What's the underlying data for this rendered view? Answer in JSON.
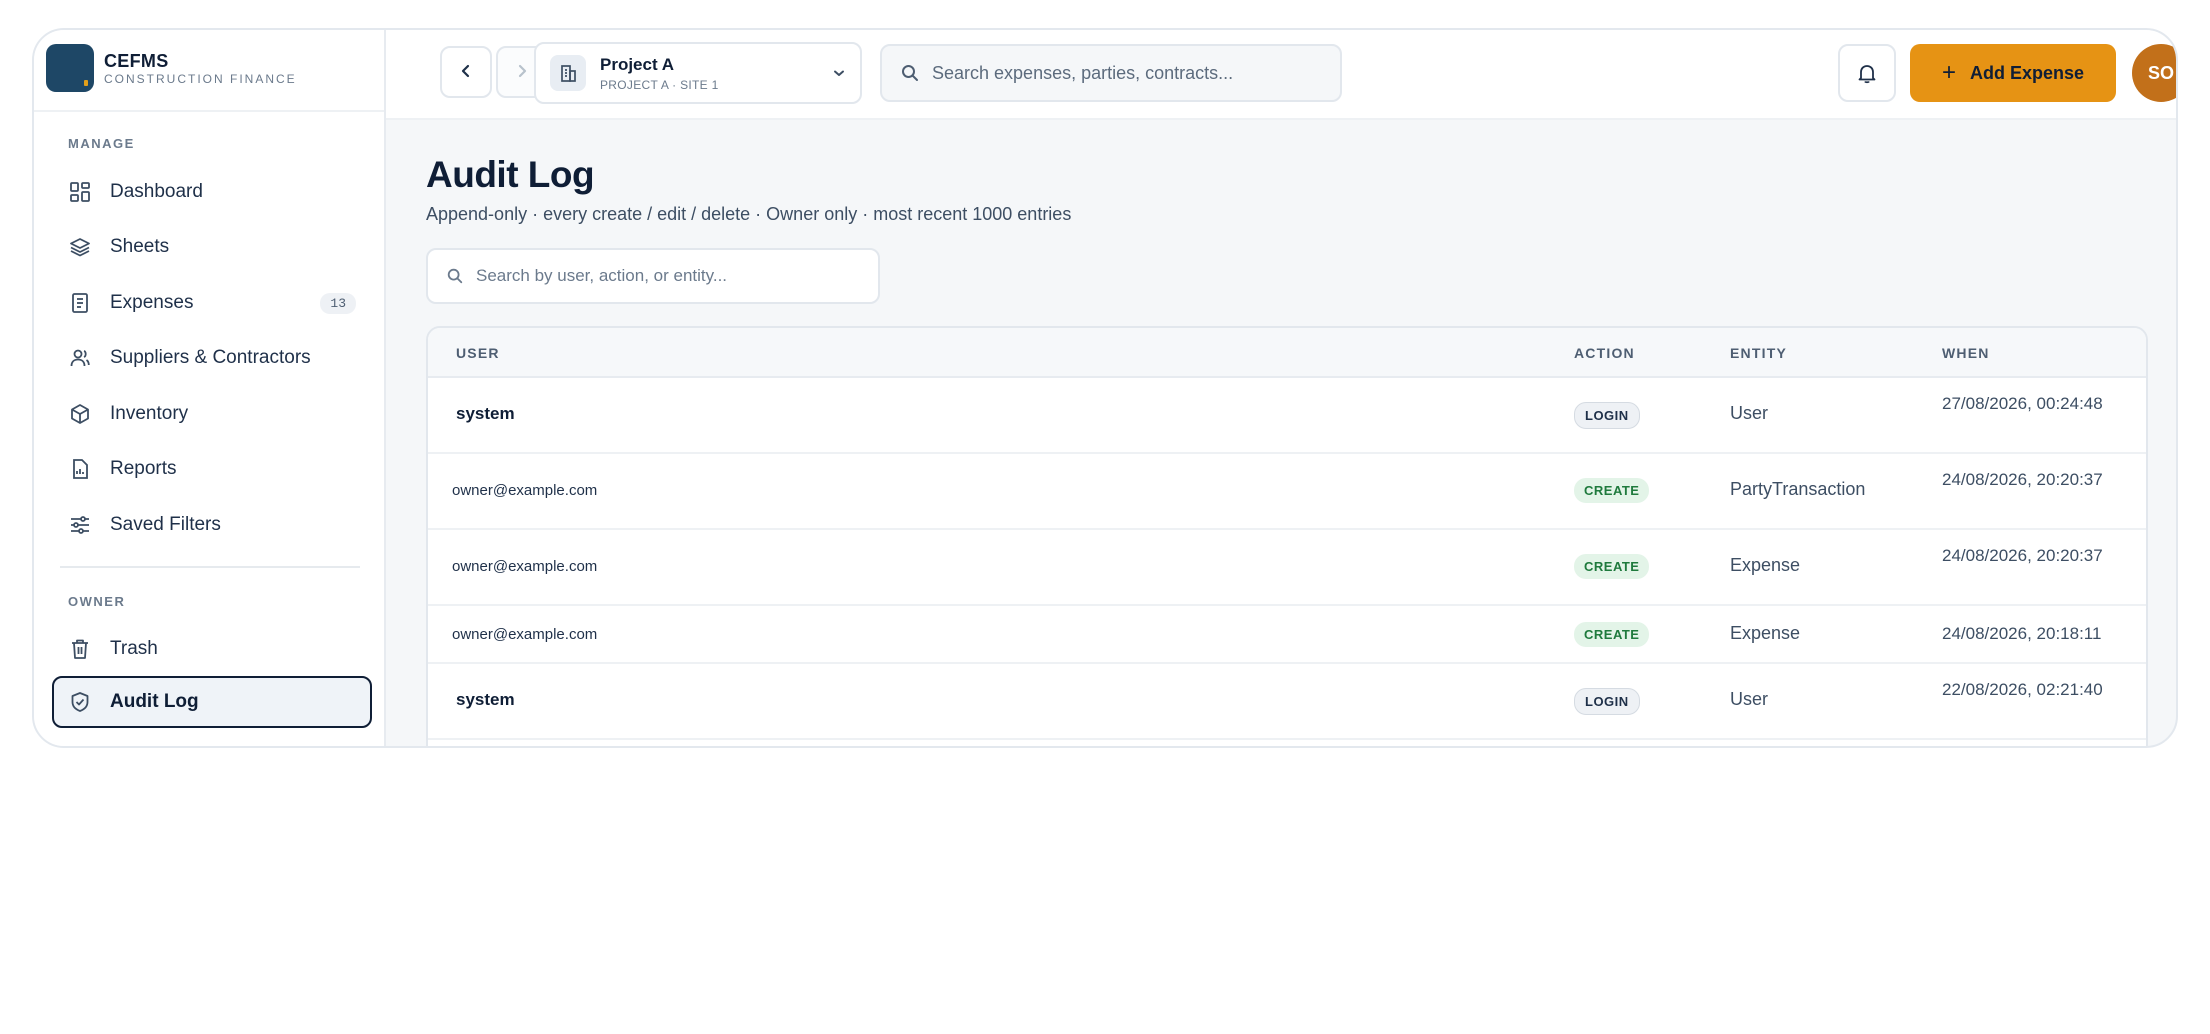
{
  "brand": {
    "name": "CEFMS",
    "subtitle": "CONSTRUCTION FINANCE"
  },
  "sidebar": {
    "manage_label": "MANAGE",
    "items": [
      {
        "label": "Dashboard",
        "icon": "dashboard-icon"
      },
      {
        "label": "Sheets",
        "icon": "layers-icon"
      },
      {
        "label": "Expenses",
        "icon": "receipt-icon",
        "count": "13"
      },
      {
        "label": "Suppliers & Contractors",
        "icon": "users-icon"
      },
      {
        "label": "Inventory",
        "icon": "box-icon"
      },
      {
        "label": "Reports",
        "icon": "report-icon"
      },
      {
        "label": "Saved Filters",
        "icon": "sliders-icon"
      }
    ],
    "owner_label": "OWNER",
    "owner_items": [
      {
        "label": "Trash",
        "icon": "trash-icon"
      },
      {
        "label": "Audit Log",
        "icon": "shield-icon",
        "active": true
      }
    ]
  },
  "topbar": {
    "project_name": "Project A",
    "project_sub": "PROJECT A · SITE 1",
    "search_placeholder": "Search expenses, parties, contracts...",
    "add_label": "Add Expense",
    "avatar_initials": "SO"
  },
  "page": {
    "title": "Audit Log",
    "subtitle": "Append-only · every create / edit / delete · Owner only · most recent 1000 entries",
    "search_placeholder": "Search by user, action, or entity..."
  },
  "table": {
    "headers": {
      "user": "USER",
      "action": "ACTION",
      "entity": "ENTITY",
      "when": "WHEN"
    },
    "rows": [
      {
        "user": "system",
        "action": "LOGIN",
        "entity": "User",
        "when": "27/08/2026, 00:24:48"
      },
      {
        "user": "owner@example.com",
        "action": "CREATE",
        "entity": "PartyTransaction",
        "when": "24/08/2026, 20:20:37"
      },
      {
        "user": "owner@example.com",
        "action": "CREATE",
        "entity": "Expense",
        "when": "24/08/2026, 20:20:37"
      },
      {
        "user": "owner@example.com",
        "action": "CREATE",
        "entity": "Expense",
        "when": "24/08/2026, 20:18:11"
      },
      {
        "user": "system",
        "action": "LOGIN",
        "entity": "User",
        "when": "22/08/2026, 02:21:40"
      }
    ]
  },
  "colors": {
    "accent": "#e69314",
    "brand": "#1e4766",
    "avatar": "#c2701a",
    "create_badge": "#e3f4e8"
  }
}
